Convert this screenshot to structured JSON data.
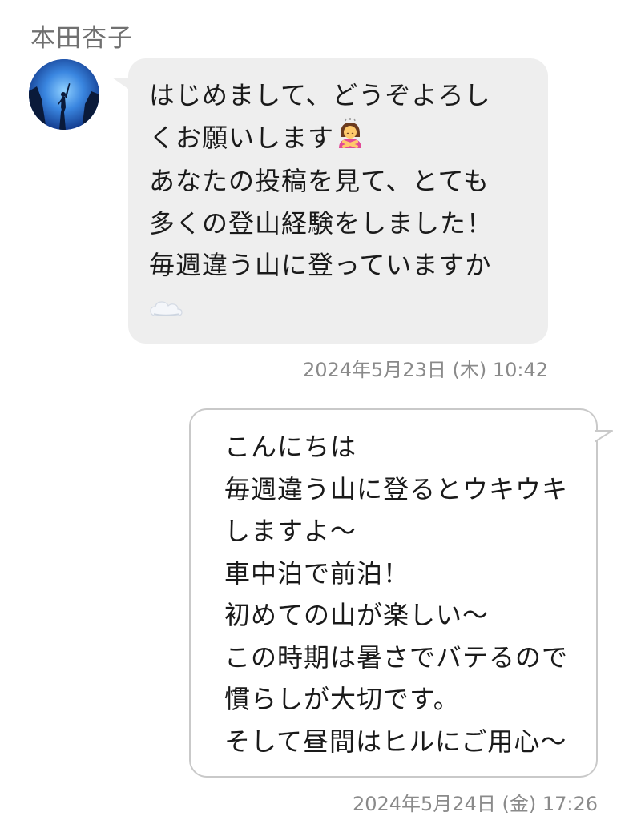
{
  "sender": {
    "name": "本田杏子",
    "avatar_icon": "mountain-climber-silhouette"
  },
  "messages": [
    {
      "direction": "incoming",
      "lines": [
        "はじめまして、どうぞよろし",
        "くお願いします",
        "あなたの投稿を見て、とても",
        "多くの登山経験をしました！",
        "毎週違う山に登っていますか"
      ],
      "emojis": [
        "person-bowing-emoji",
        "cloud-emoji"
      ],
      "timestamp": "2024年5月23日 (木) 10:42"
    },
    {
      "direction": "outgoing",
      "lines": [
        "こんにちは",
        "毎週違う山に登るとウキウキ",
        "しますよ〜",
        "車中泊で前泊！",
        "初めての山が楽しい〜",
        "この時期は暑さでバテるので",
        "慣らしが大切です。",
        "そして昼間はヒルにご用心〜"
      ],
      "timestamp": "2024年5月24日 (金) 17:26"
    }
  ],
  "colors": {
    "incoming_bubble": "#eeeeee",
    "outgoing_bubble": "#ffffff",
    "outgoing_border": "#c9c9c9",
    "timestamp_text": "#8a8a8a"
  }
}
